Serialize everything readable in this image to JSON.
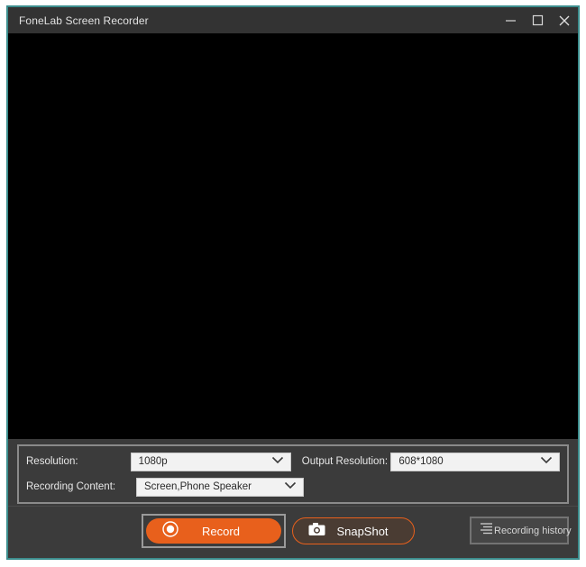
{
  "window": {
    "title": "FoneLab Screen Recorder",
    "accent_border_color": "#3c8e8e",
    "titlebar_color": "#333333",
    "panel_color": "#3b3b3b",
    "brand_orange": "#e8601c",
    "controls": [
      {
        "name": "minimize",
        "icon": "minimize-icon",
        "label": "—"
      },
      {
        "name": "maximize",
        "icon": "maximize-icon",
        "label": "□"
      },
      {
        "name": "close",
        "icon": "close-icon",
        "label": "✕"
      }
    ]
  },
  "preview": {
    "background_color": "#000000",
    "content": ""
  },
  "settings": {
    "resolution": {
      "label": "Resolution:",
      "value": "1080p",
      "icon": "chevron-down-icon"
    },
    "recording_content": {
      "label": "Recording Content:",
      "value": "Screen,Phone Speaker",
      "icon": "chevron-down-icon"
    },
    "output_resolution": {
      "label": "Output Resolution:",
      "value": "608*1080",
      "icon": "chevron-down-icon"
    }
  },
  "actions": {
    "record": {
      "label": "Record",
      "icon": "record-circle-icon",
      "color": "#e8601c",
      "focused": true
    },
    "snapshot": {
      "label": "SnapShot",
      "icon": "camera-icon",
      "border_color": "#e8601c"
    },
    "history": {
      "label": "Recording history",
      "icon": "list-lines-icon"
    }
  }
}
